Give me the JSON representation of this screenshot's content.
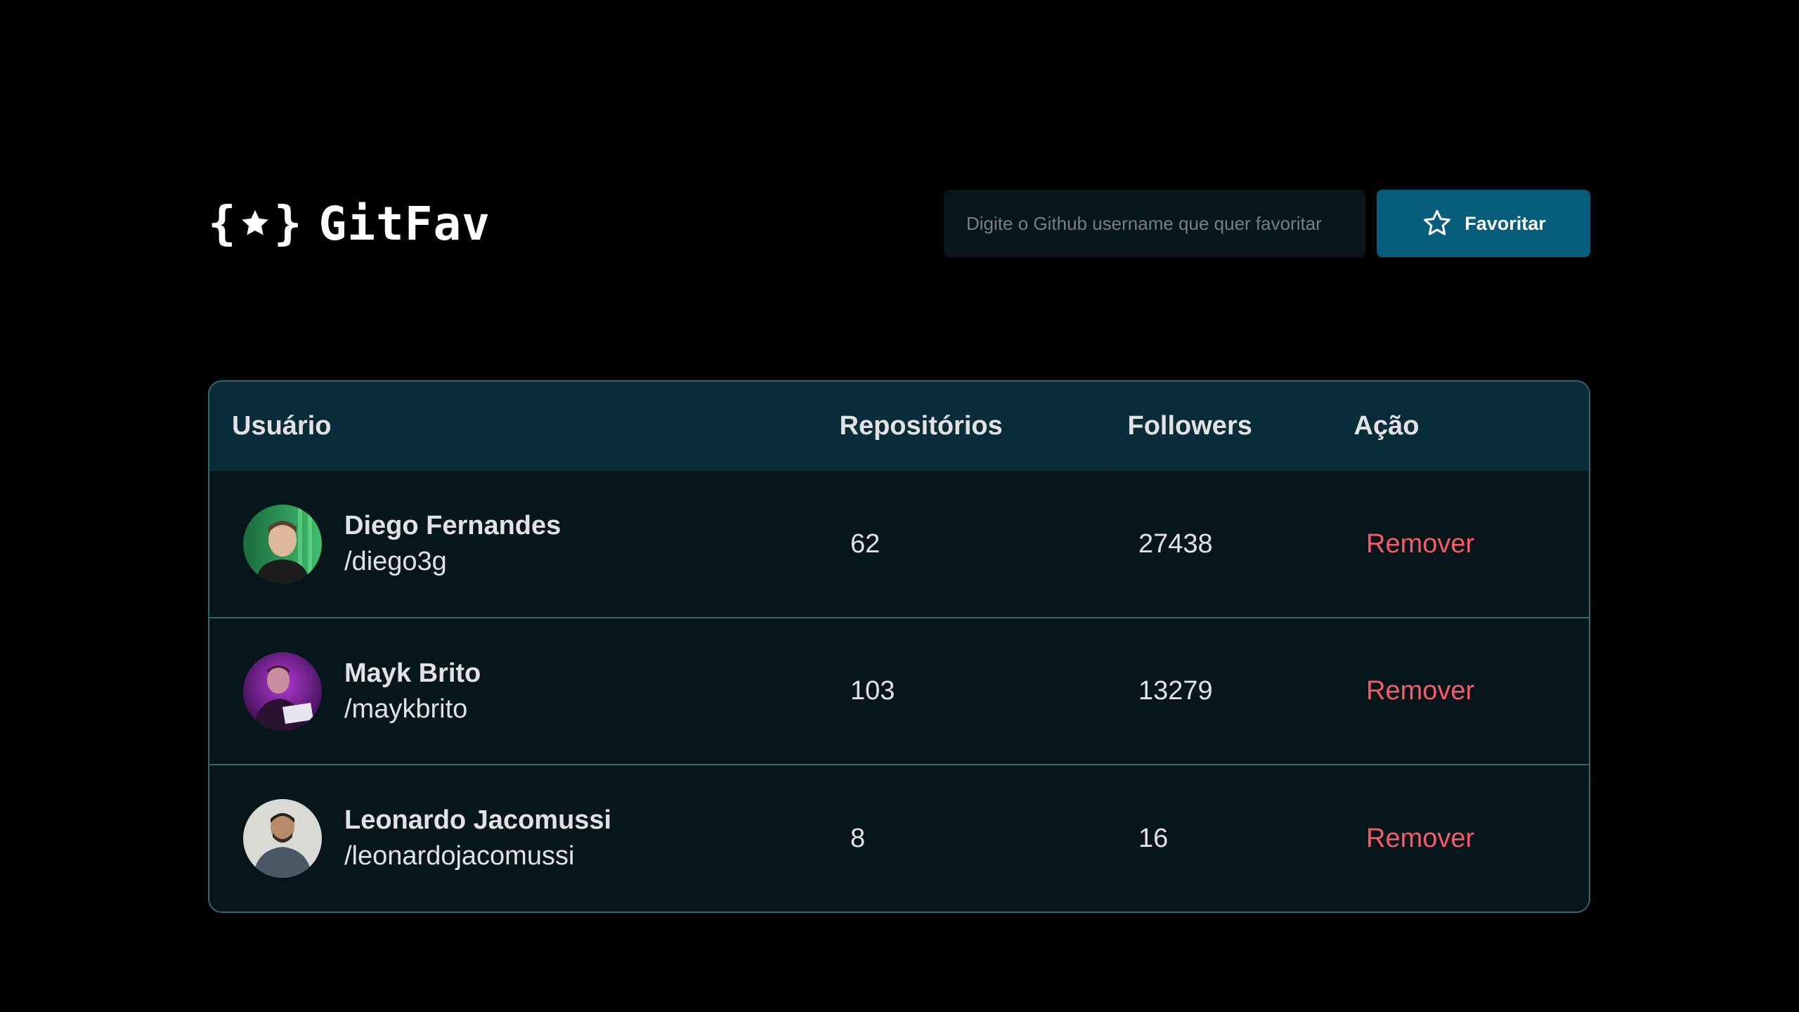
{
  "app": {
    "title": "GitFav",
    "logo_icon": "braces-star-icon"
  },
  "search": {
    "placeholder": "Digite o Github username que quer favoritar",
    "value": "",
    "button_label": "Favoritar",
    "button_icon": "star-outline-icon"
  },
  "table": {
    "headers": {
      "user": "Usuário",
      "repos": "Repositórios",
      "followers": "Followers",
      "action": "Ação"
    },
    "rows": [
      {
        "name": "Diego Fernandes",
        "login": "/diego3g",
        "repos": "62",
        "followers": "27438",
        "action": "Remover"
      },
      {
        "name": "Mayk Brito",
        "login": "/maykbrito",
        "repos": "103",
        "followers": "13279",
        "action": "Remover"
      },
      {
        "name": "Leonardo Jacomussi",
        "login": "/leonardojacomussi",
        "repos": "8",
        "followers": "16",
        "action": "Remover"
      }
    ]
  },
  "colors": {
    "background": "#000000",
    "accent": "#065E7C",
    "header_row": "#092D38",
    "row_bg": "#06161B",
    "border": "#2F6A73",
    "remove": "#F75A68"
  }
}
